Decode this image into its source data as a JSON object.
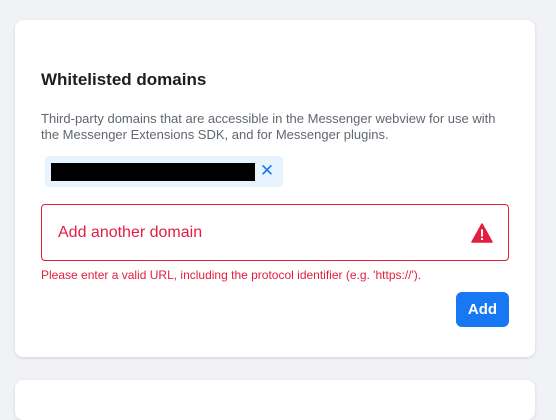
{
  "section": {
    "title": "Whitelisted domains",
    "description": "Third-party domains that are accessible in the Messenger webview for use with the Messenger Extensions SDK, and for Messenger plugins."
  },
  "domains": [
    {
      "value": "",
      "redacted": true,
      "remove_icon": "close-icon"
    }
  ],
  "domain_input": {
    "placeholder": "Add another domain",
    "value": "",
    "status_icon": "warning-icon",
    "error": "Please enter a valid URL, including the protocol identifier (e.g. 'https://')."
  },
  "add_button": {
    "label": "Add"
  },
  "colors": {
    "accent": "#1877f2",
    "error": "#e41e3f",
    "chip_bg": "#e7f3ff",
    "page_bg": "#f0f2f5"
  }
}
